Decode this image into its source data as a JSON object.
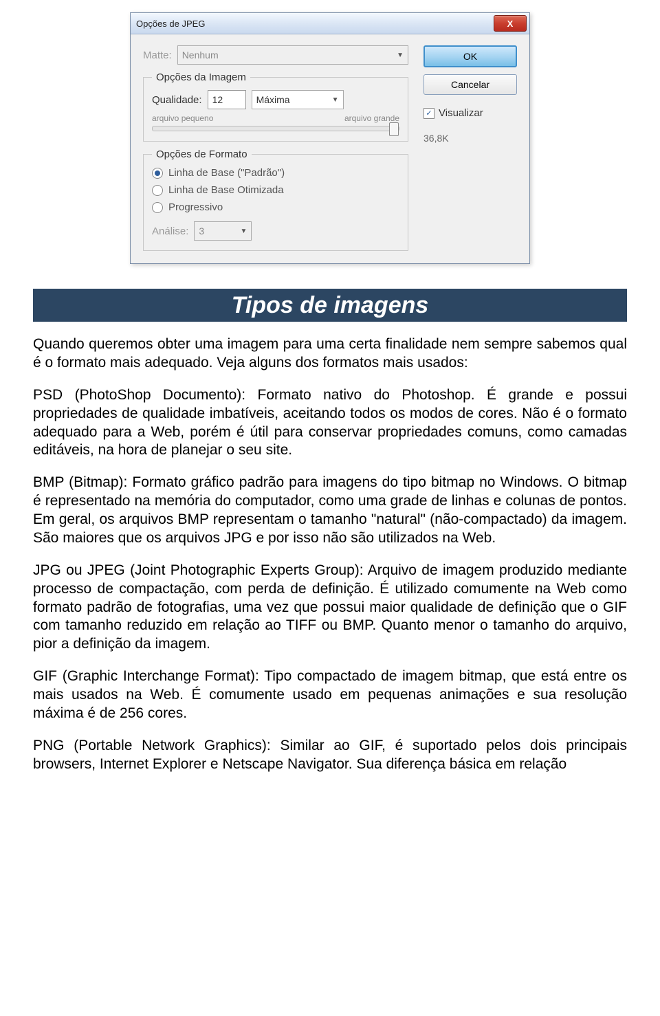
{
  "dialog": {
    "title": "Opções de JPEG",
    "close": "X",
    "matte_label": "Matte:",
    "matte_value": "Nenhum",
    "image_group": "Opções da Imagem",
    "quality_label": "Qualidade:",
    "quality_value": "12",
    "quality_preset": "Máxima",
    "slider_small": "arquivo pequeno",
    "slider_large": "arquivo grande",
    "format_group": "Opções de Formato",
    "fmt1": "Linha de Base (\"Padrão\")",
    "fmt2": "Linha de Base Otimizada",
    "fmt3": "Progressivo",
    "scans_label": "Análise:",
    "scans_value": "3",
    "ok": "OK",
    "cancel": "Cancelar",
    "preview": "Visualizar",
    "filesize": "36,8K",
    "check": "✓"
  },
  "article": {
    "title": "Tipos de imagens",
    "p1": "Quando queremos obter uma imagem para uma certa finalidade nem sempre sabemos qual é o formato mais adequado. Veja alguns dos formatos mais usados:",
    "p2": "PSD (PhotoShop Documento): Formato nativo do Photoshop. É grande e possui propriedades de qualidade imbatíveis, aceitando todos os modos de cores. Não é o formato adequado para a Web, porém é útil para conservar propriedades comuns, como camadas editáveis, na hora de planejar o seu site.",
    "p3": "BMP (Bitmap): Formato gráfico padrão para imagens do tipo bitmap no Windows. O bitmap é representado na memória do computador, como uma grade de linhas e colunas de pontos. Em geral, os arquivos BMP representam o tamanho \"natural\" (não-compactado) da imagem. São maiores que os arquivos JPG e por isso não são utilizados na Web.",
    "p4": "JPG ou JPEG (Joint Photographic Experts Group): Arquivo de imagem produzido mediante processo de compactação, com perda de definição. É utilizado comumente na Web como formato padrão de fotografias, uma vez que possui maior qualidade de definição que o GIF com tamanho reduzido em relação ao TIFF ou BMP. Quanto menor o tamanho do arquivo, pior a definição da imagem.",
    "p5": "GIF (Graphic Interchange Format): Tipo compactado de imagem bitmap, que está entre os mais usados na Web. É comumente usado em pequenas animações e sua resolução máxima é de 256 cores.",
    "p6": "PNG (Portable Network Graphics): Similar ao GIF, é suportado pelos dois principais browsers, Internet Explorer e Netscape Navigator. Sua diferença básica em relação"
  }
}
